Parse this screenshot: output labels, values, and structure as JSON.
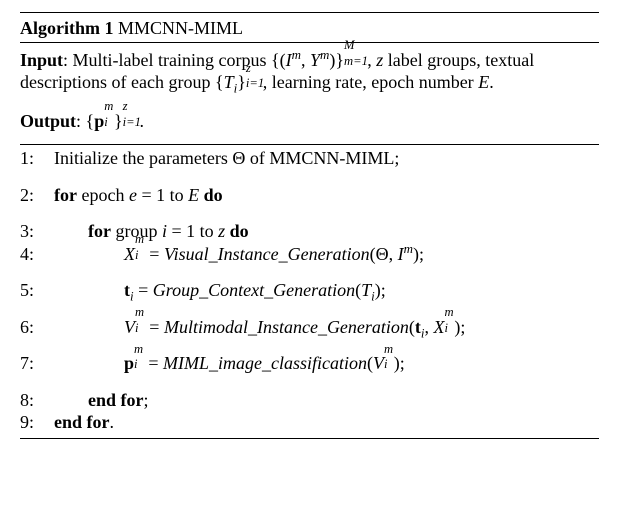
{
  "title": {
    "label": "Algorithm 1",
    "name": "MMCNN-MIML"
  },
  "input_label": "Input",
  "input_body_a": ": Multi-label training corpus ",
  "set_open": "{(",
  "I": "I",
  "m": "m",
  "comma": ", ",
  "Y": "Y",
  "set_close": ")}",
  "M": "M",
  "meq1": "m=1",
  "z": "z",
  "input_body_b": " label groups, textual descriptions of each group ",
  "T_open": "{",
  "T": "T",
  "i": "i",
  "T_close": "}",
  "ieq1": "i=1",
  "input_body_c": ", learning rate, epoch number ",
  "E": "E",
  "period": ".",
  "output_label": "Output",
  "p": "p",
  "colon": ": ",
  "steps": {
    "s1": {
      "n": "1:",
      "a": "Initialize the parameters ",
      "theta": "Θ",
      "b": " of MMCNN-MIML;"
    },
    "s2": {
      "n": "2:",
      "for": "for",
      "a": " epoch ",
      "e": "e",
      "eq": " = 1 to ",
      "do": "do"
    },
    "s3": {
      "n": "3:",
      "for": "for",
      "a": " group ",
      "eq": " = 1 to ",
      "do": "do"
    },
    "s4": {
      "n": "4:",
      "X": "X",
      "eq": " = ",
      "fn": "Visual",
      "us": "_",
      "fn2": "Instance",
      "fn3": "Generation",
      "open": "(",
      "close": ");"
    },
    "s5": {
      "n": "5:",
      "t": "t",
      "eq": " = ",
      "fn": "Group",
      "fn2": "Context",
      "fn3": "Generation",
      "open": "(",
      "close": ");"
    },
    "s6": {
      "n": "6:",
      "V": "V",
      "eq": " = ",
      "fn": "Multimodal",
      "fn2": "Instance",
      "fn3": "Generation",
      "open": "(",
      "close": ");"
    },
    "s7": {
      "n": "7:",
      "eq": " = ",
      "fn": "MIML",
      "fn2": "image",
      "fn3": "classification",
      "open": "(",
      "close": ");"
    },
    "s8": {
      "n": "8:",
      "txt": "end for",
      "semi": ";"
    },
    "s9": {
      "n": "9:",
      "txt": "end for",
      "dot": "."
    }
  }
}
